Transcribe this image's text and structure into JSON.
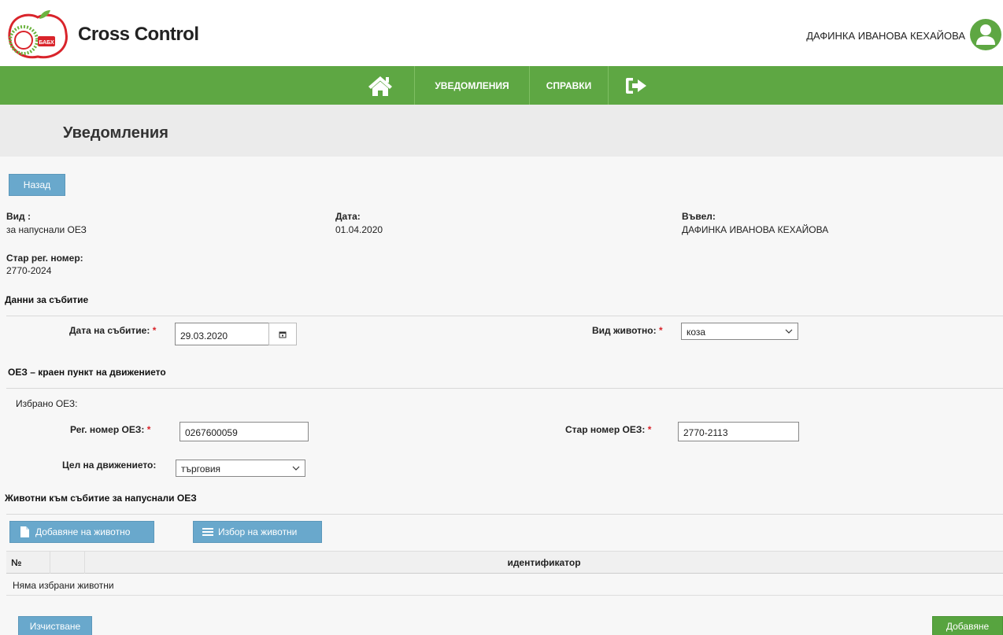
{
  "header": {
    "logo_text": "БАБХ",
    "app_title": "Cross Control",
    "user_name": "ДАФИНКА ИВАНОВА КЕХАЙОВА"
  },
  "nav": {
    "items": [
      {
        "icon": "home-icon"
      },
      {
        "label": "УВЕДОМЛЕНИЯ"
      },
      {
        "label": "СПРАВКИ"
      },
      {
        "icon": "logout-icon"
      }
    ]
  },
  "page": {
    "title": "Уведомления"
  },
  "buttons": {
    "back": "Назад",
    "add_animal": "Добавяне на животно",
    "select_animals": "Избор на животни",
    "clear": "Изчистване",
    "add": "Добавяне"
  },
  "info": {
    "type_label": "Вид :",
    "type_value": "за напуснали ОЕЗ",
    "date_label": "Дата:",
    "date_value": "01.04.2020",
    "entered_by_label": "Въвел:",
    "entered_by_value": "ДАФИНКА ИВАНОВА КЕХАЙОВА",
    "old_reg_label": "Стар рег. номер:",
    "old_reg_value": "2770-2024"
  },
  "event": {
    "section_title": "Данни за събитие",
    "event_date_label": "Дата на събитие:",
    "event_date_value": "29.03.2020",
    "animal_type_label": "Вид животно:",
    "animal_type_value": "коза"
  },
  "destination": {
    "section_title": "ОЕЗ – краен пункт на движението",
    "selected_label": "Избрано ОЕЗ:",
    "reg_no_label": "Рег. номер ОЕЗ:",
    "reg_no_value": "0267600059",
    "old_no_label": "Стар номер ОЕЗ:",
    "old_no_value": "2770-2113",
    "purpose_label": "Цел на движението:",
    "purpose_value": "търговия"
  },
  "animals": {
    "section_title": "Животни към събитие за напуснали ОЕЗ",
    "columns": [
      "№",
      "",
      "идентификатор"
    ],
    "empty_text": "Няма избрани животни"
  },
  "required_mark": "*",
  "colors": {
    "brand_green": "#5ea743",
    "button_blue": "#69a8cc",
    "required_red": "#d9242b",
    "logo_red": "#d9242b"
  }
}
